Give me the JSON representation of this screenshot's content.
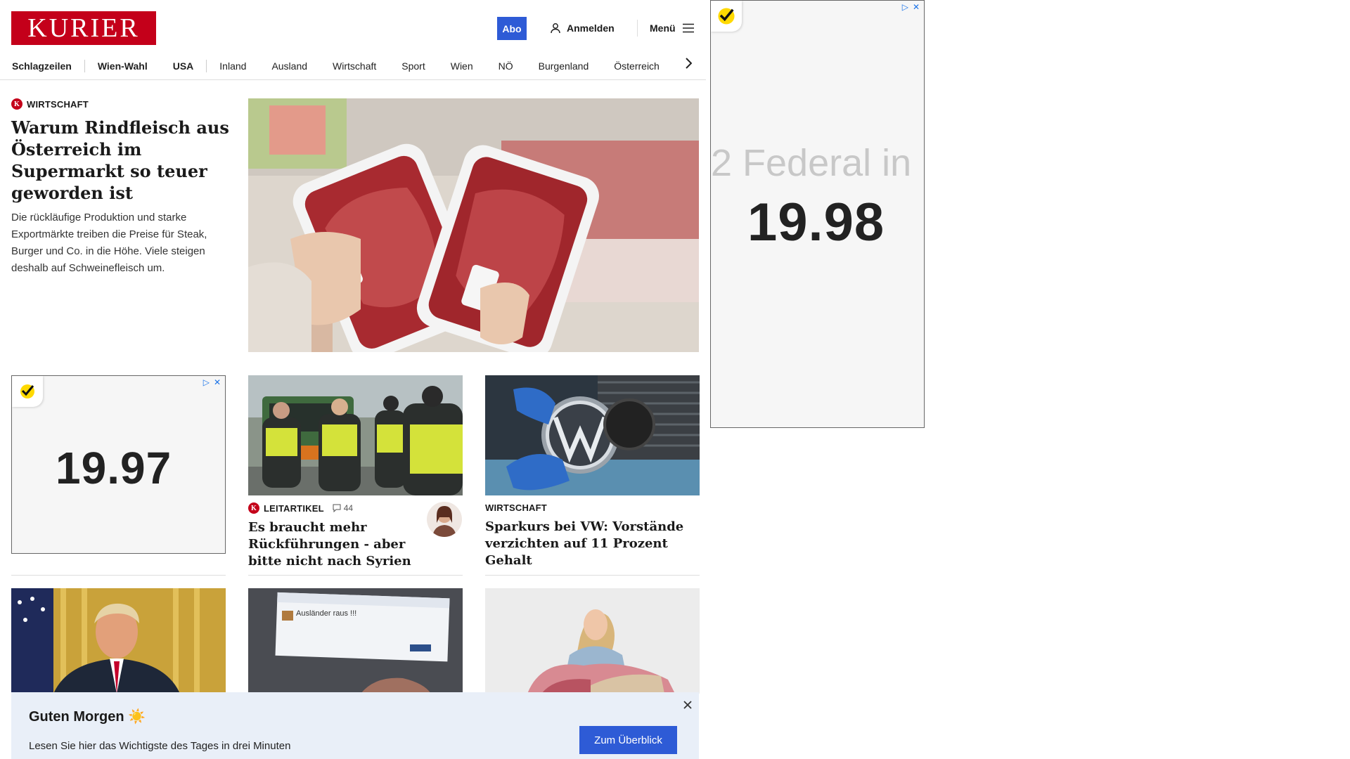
{
  "header": {
    "logo_text": "KURIER",
    "abo_label": "Abo",
    "login_label": "Anmelden",
    "menu_label": "Menü"
  },
  "nav": {
    "items": [
      "Schlagzeilen",
      "Wien-Wahl",
      "USA",
      "Inland",
      "Ausland",
      "Wirtschaft",
      "Sport",
      "Wien",
      "NÖ",
      "Burgenland",
      "Österreich"
    ]
  },
  "lead": {
    "kicker": "WIRTSCHAFT",
    "title": "Warum Rindfleisch aus Österreich im Supermarkt so teuer geworden ist",
    "teaser": "Die rückläufige Produktion und starke Exportmärkte treiben die Preise für Steak, Burger und Co. in die Höhe. Viele steigen deshalb auf Schweinefleisch um."
  },
  "ads": {
    "small_value": "19.97",
    "right_value": "19.98",
    "right_faded": "2  Federal in"
  },
  "cards": [
    {
      "kicker": "LEITARTIKEL",
      "comments": "44",
      "title": "Es braucht mehr Rückführungen - aber bitte nicht nach Syrien"
    },
    {
      "kicker": "WIRTSCHAFT",
      "title": "Sparkurs bei VW: Vorstände verzichten auf 11 Prozent Gehalt"
    }
  ],
  "row2": {
    "post_text": "Ausländer raus !!!"
  },
  "banner": {
    "title": "Guten Morgen ☀️",
    "subtitle": "Lesen Sie hier das Wichtigste des Tages in drei Minuten",
    "button": "Zum Überblick"
  },
  "colors": {
    "brand": "#c4001a",
    "accent": "#2e5bd6",
    "banner_bg": "#e9eff8"
  }
}
